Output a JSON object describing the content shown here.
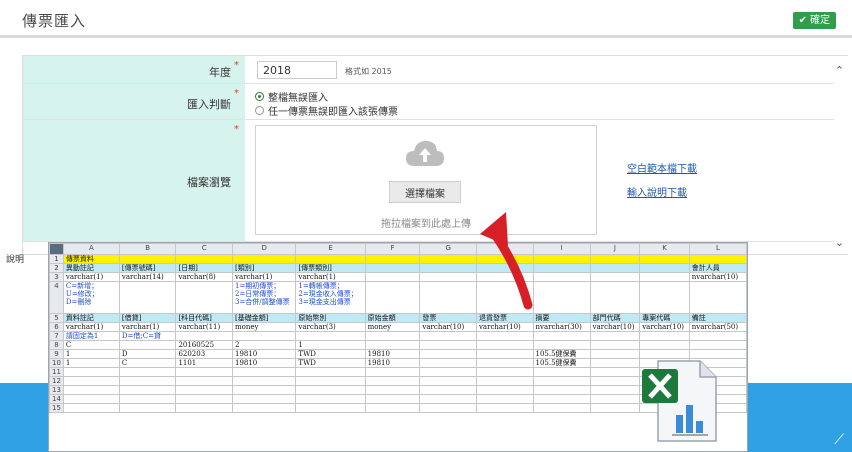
{
  "header": {
    "title": "傳票匯入",
    "confirm_label": "確定",
    "confirm_icon": "check-icon"
  },
  "form": {
    "year": {
      "label": "年度",
      "value": "2018",
      "hint": "格式如 2015"
    },
    "import_mode": {
      "label": "匯入判斷",
      "options": [
        "整檔無誤匯入",
        "任一傳票無誤即匯入該張傳票"
      ],
      "selected": 0
    },
    "file": {
      "label": "檔案瀏覽",
      "choose_label": "選擇檔案",
      "drop_hint": "拖拉檔案到此處上傳",
      "icon": "cloud-upload-icon"
    },
    "links": {
      "template": "空白範本檔下載",
      "guide": "輸入說明下載"
    },
    "required_mark": "*",
    "note_label": "說明"
  },
  "sheet": {
    "columns": [
      "A",
      "B",
      "C",
      "D",
      "E",
      "F",
      "G",
      "H",
      "I",
      "J",
      "K",
      "L"
    ],
    "rows": [
      [
        "傳票資料",
        "",
        "",
        "",
        "",
        "",
        "",
        "",
        "",
        "",
        "",
        ""
      ],
      [
        "異動註記",
        "[傳票號碼]",
        "[日期]",
        "[類別]",
        "[傳票類別]",
        "",
        "",
        "",
        "",
        "",
        "",
        "會計人員"
      ],
      [
        "varchar(1)",
        "varchar(14)",
        "varchar(8)",
        "varchar(1)",
        "varchar(1)",
        "",
        "",
        "",
        "",
        "",
        "",
        "nvarchar(10)"
      ],
      [
        "C=新增；\nU=修改；\nD=刪除",
        "",
        "",
        "1=期初傳票；\n2=日常傳票；\n3=合併/調整傳票",
        "1=轉帳傳票；\n2=現金收入傳票；\n3=現金支出傳票",
        "",
        "",
        "",
        "",
        "",
        "",
        ""
      ],
      [
        "資料註記",
        "[借貸]",
        "[科目代碼]",
        "[基礎金額]",
        "原始幣別",
        "原始金額",
        "發票",
        "退貨發票",
        "摘要",
        "部門代碼",
        "專案代碼",
        "備註"
      ],
      [
        "varchar(1)",
        "varchar(1)",
        "varchar(11)",
        "money",
        "varchar(3)",
        "money",
        "varchar(10)",
        "varchar(10)",
        "nvarchar(30)",
        "varchar(10)",
        "varchar(10)",
        "nvarchar(50)"
      ],
      [
        "請固定為1",
        "D=借;C=貸",
        "",
        "",
        "",
        "",
        "",
        "",
        "",
        "",
        "",
        ""
      ],
      [
        "C",
        "",
        "20160525",
        "2",
        "1",
        "",
        "",
        "",
        "",
        "",
        "",
        ""
      ],
      [
        "1",
        "D",
        "620203",
        "19810",
        "TWD",
        "19810",
        "",
        "",
        "105.5健保費",
        "",
        "",
        ""
      ],
      [
        "1",
        "C",
        "1101",
        "19810",
        "TWD",
        "19810",
        "",
        "",
        "105.5健保費",
        "",
        "",
        ""
      ],
      [
        "",
        "",
        "",
        "",
        "",
        "",
        "",
        "",
        "",
        "",
        "",
        ""
      ],
      [
        "",
        "",
        "",
        "",
        "",
        "",
        "",
        "",
        "",
        "",
        "",
        ""
      ],
      [
        "",
        "",
        "",
        "",
        "",
        "",
        "",
        "",
        "",
        "",
        "",
        ""
      ],
      [
        "",
        "",
        "",
        "",
        "",
        "",
        "",
        "",
        "",
        "",
        "",
        ""
      ],
      [
        "",
        "",
        "",
        "",
        "",
        "",
        "",
        "",
        "",
        "",
        "",
        ""
      ]
    ],
    "row_numbers": [
      "1",
      "2",
      "3",
      "4",
      "5",
      "6",
      "7",
      "8",
      "9",
      "10",
      "11",
      "12",
      "13",
      "14",
      "15"
    ],
    "fill_yellow": "#fff200",
    "fill_cyan": "#bfeaf5"
  },
  "colors": {
    "accent_green": "#2e9e4b",
    "label_bg": "#d7f3ed",
    "link": "#1e5aa8",
    "band": "#2fa2e6",
    "arrow": "#d61f26"
  },
  "icons": [
    "check-icon",
    "cloud-upload-icon",
    "excel-file-icon",
    "red-curved-arrow",
    "chevron-up-icon",
    "chevron-down-icon"
  ]
}
